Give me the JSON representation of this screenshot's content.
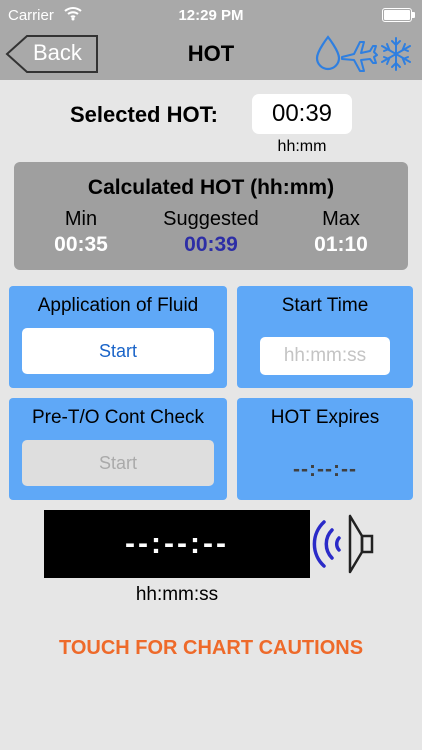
{
  "status_bar": {
    "carrier": "Carrier",
    "time": "12:29 PM"
  },
  "nav": {
    "back_label": "Back",
    "title": "HOT"
  },
  "selected": {
    "label": "Selected HOT:",
    "value": "00:39",
    "unit": "hh:mm"
  },
  "calculated": {
    "title": "Calculated HOT (hh:mm)",
    "min_label": "Min",
    "min_value": "00:35",
    "suggested_label": "Suggested",
    "suggested_value": "00:39",
    "max_label": "Max",
    "max_value": "01:10"
  },
  "application": {
    "title": "Application of Fluid",
    "button": "Start"
  },
  "start_time": {
    "title": "Start Time",
    "placeholder": "hh:mm:ss"
  },
  "check": {
    "title": "Pre-T/O Cont Check",
    "button": "Start"
  },
  "expires": {
    "title": "HOT Expires",
    "value": "--:--:--"
  },
  "timer": {
    "value": "--:--:--",
    "unit": "hh:mm:ss"
  },
  "cautions_link": "TOUCH FOR CHART CAUTIONS",
  "colors": {
    "panel": "#5fa8f7",
    "accent_orange": "#ee6a2a",
    "suggested": "#2d2ea6",
    "icon_blue": "#2f7fe0"
  }
}
